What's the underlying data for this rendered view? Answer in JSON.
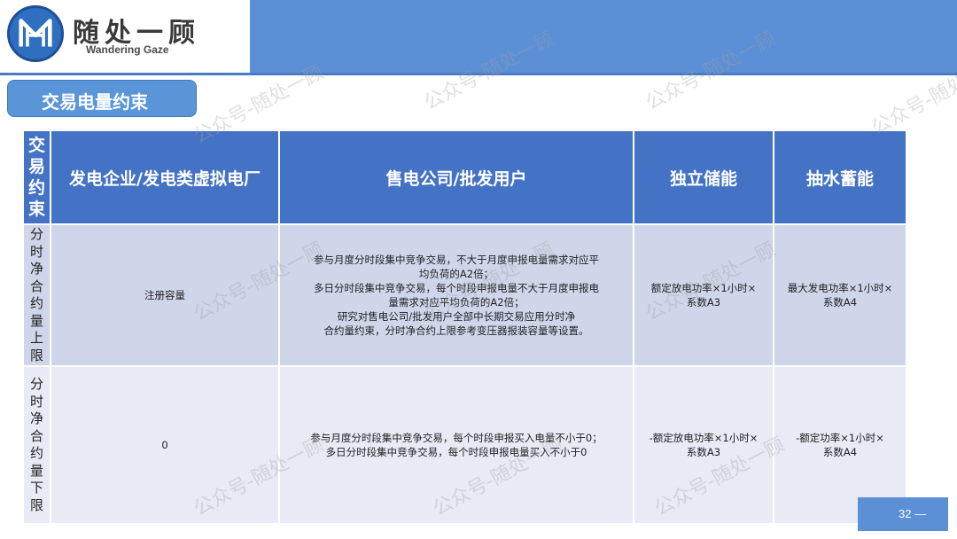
{
  "logo": {
    "title": "随处一顾",
    "subtitle": "Wandering Gaze"
  },
  "section": {
    "title": "交易电量约束"
  },
  "table": {
    "header": {
      "corner_label": "交易约束",
      "columns": [
        "发电企业/发电类虚拟电厂",
        "售电公司/批发用户",
        "独立储能",
        "抽水蓄能"
      ]
    },
    "rows": [
      {
        "label": "分时净合约量上限",
        "cells": [
          [
            "注册容量"
          ],
          [
            "参与月度分时段集中竞争交易，不大于月度申报电量需求对应平",
            "均负荷的A2倍；",
            "多日分时段集中竞争交易，每个时段申报电量不大于月度申报电",
            "量需求对应平均负荷的A2倍；",
            "研究对售电公司/批发用户全部中长期交易应用分时净",
            "合约量约束，分时净合约上限参考变压器报装容量等设置。"
          ],
          [
            "额定放电功率×1小时×",
            "系数A3"
          ],
          [
            "最大发电功率×1小时×",
            "系数A4"
          ]
        ]
      },
      {
        "label": "分时净合约量下限",
        "cells": [
          [
            "0"
          ],
          [
            "参与月度分时段集中竞争交易，每个时段申报买入电量不小于0；",
            "多日分时段集中竞争交易，每个时段申报电量买入不小于0"
          ],
          [
            "-额定放电功率×1小时×",
            "系数A3"
          ],
          [
            "-额定功率×1小时×",
            "系数A4"
          ]
        ]
      }
    ]
  },
  "page_number": "32 —",
  "watermark": "公众号-随处一顾",
  "colors": {
    "header_band": "#5b8fd6",
    "table_header": "#4472c4",
    "row1": "#cfd6ea",
    "row2": "#e8ebf5"
  }
}
